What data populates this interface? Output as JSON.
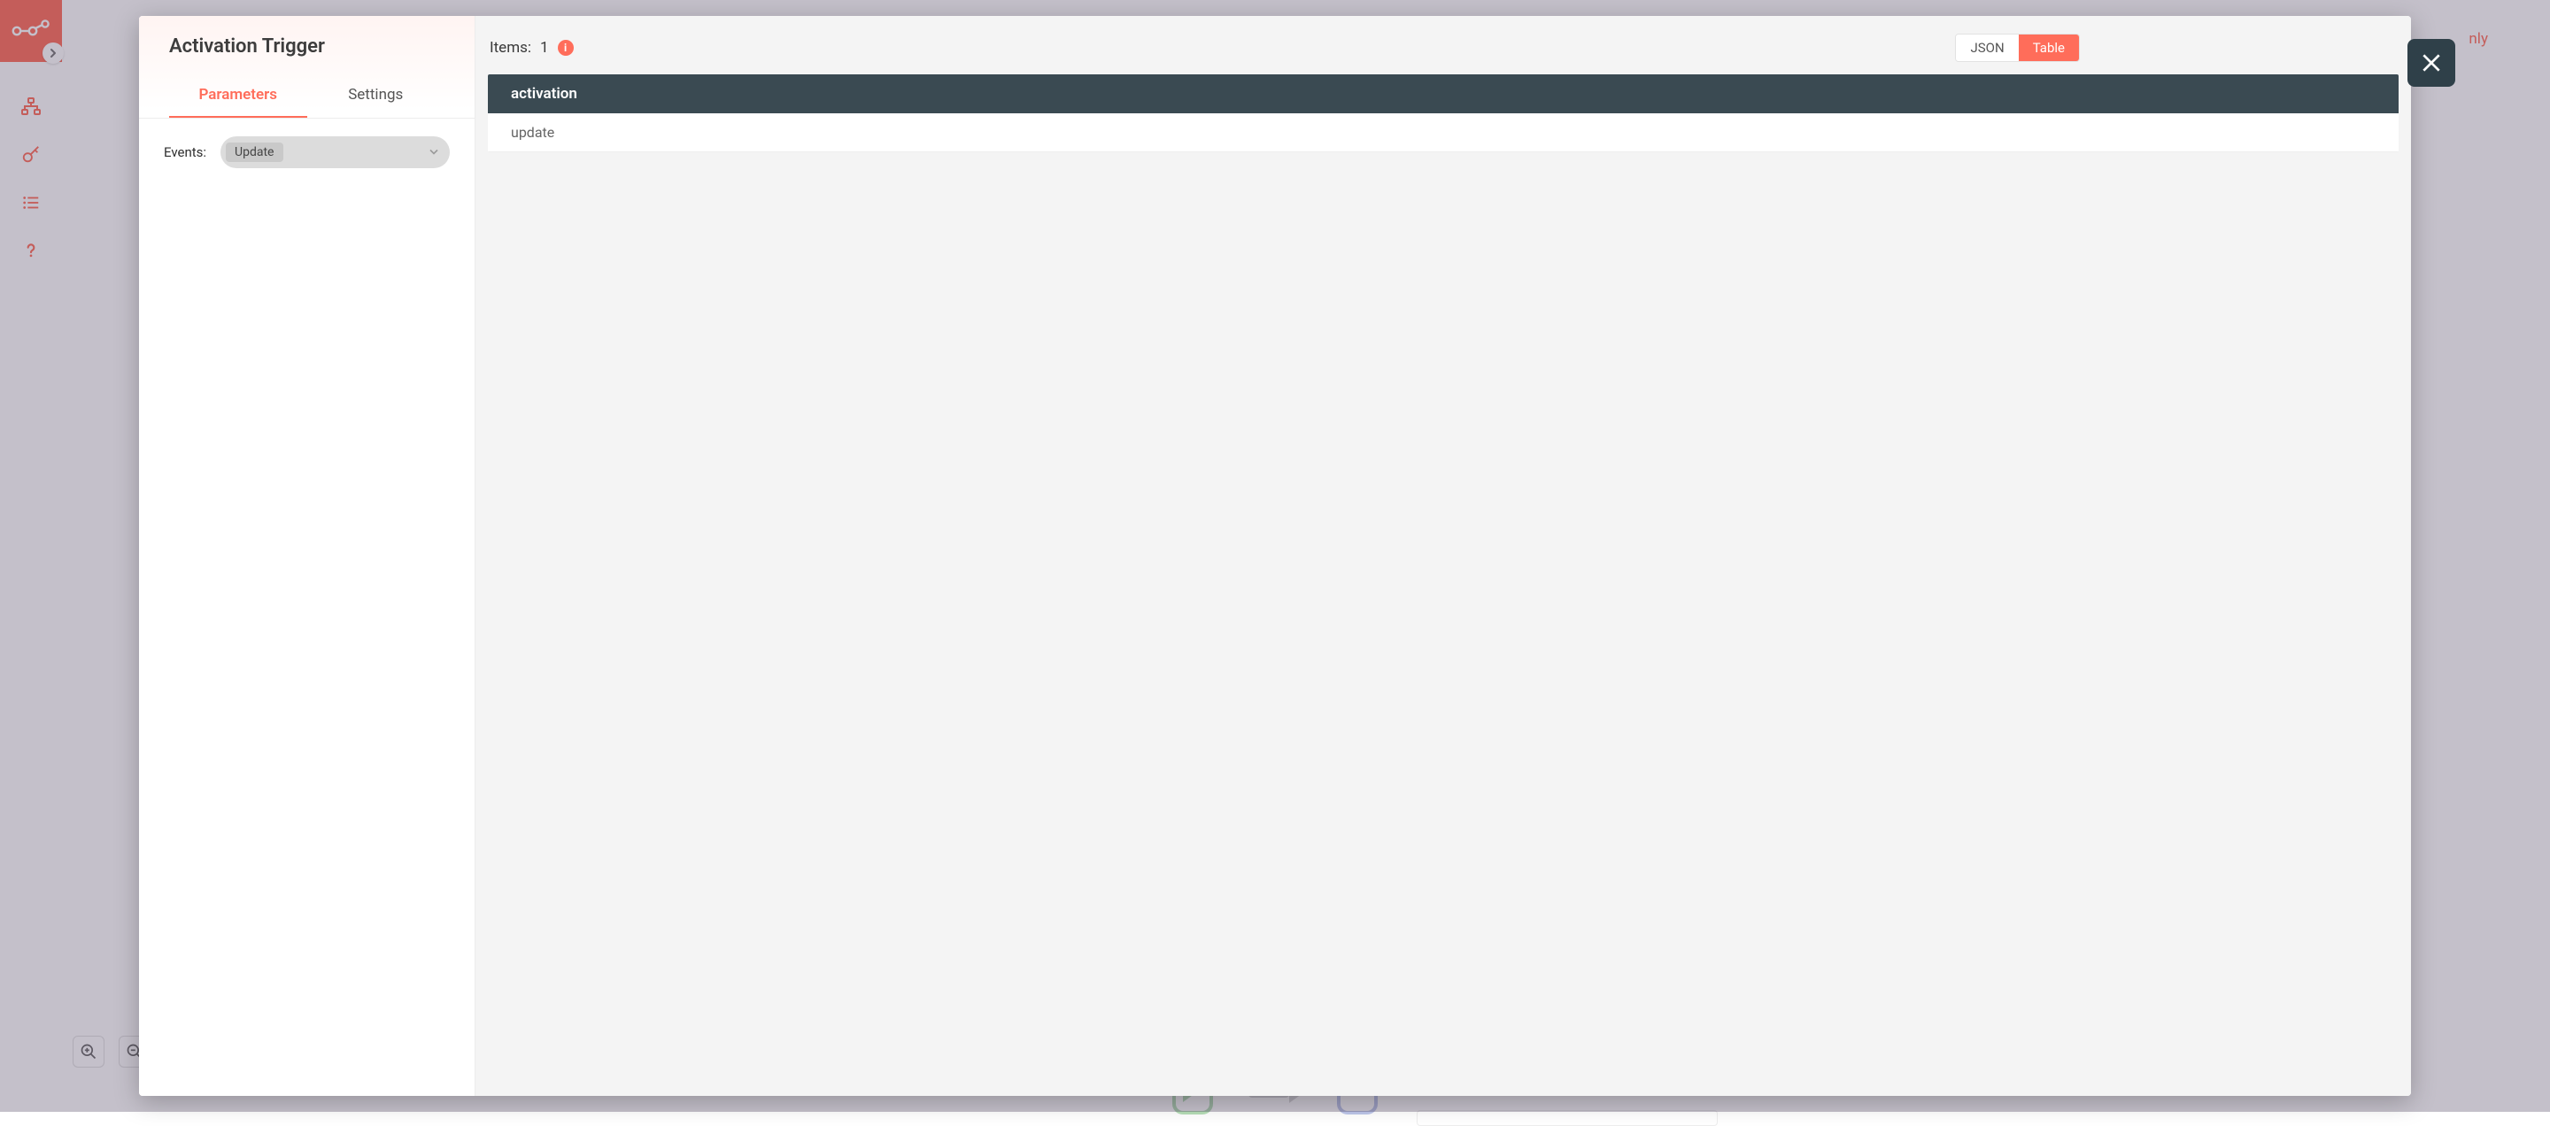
{
  "background": {
    "top_right_text": "nly"
  },
  "modal": {
    "title": "Activation Trigger",
    "tabs": {
      "parameters": "Parameters",
      "settings": "Settings",
      "active": "parameters"
    },
    "params": {
      "events": {
        "label": "Events:",
        "selected": "Update"
      }
    },
    "output": {
      "items_label": "Items:",
      "items_count": "1",
      "view_toggle": {
        "json": "JSON",
        "table": "Table",
        "active": "table"
      },
      "table": {
        "column_header": "activation",
        "rows": [
          "update"
        ]
      }
    }
  }
}
